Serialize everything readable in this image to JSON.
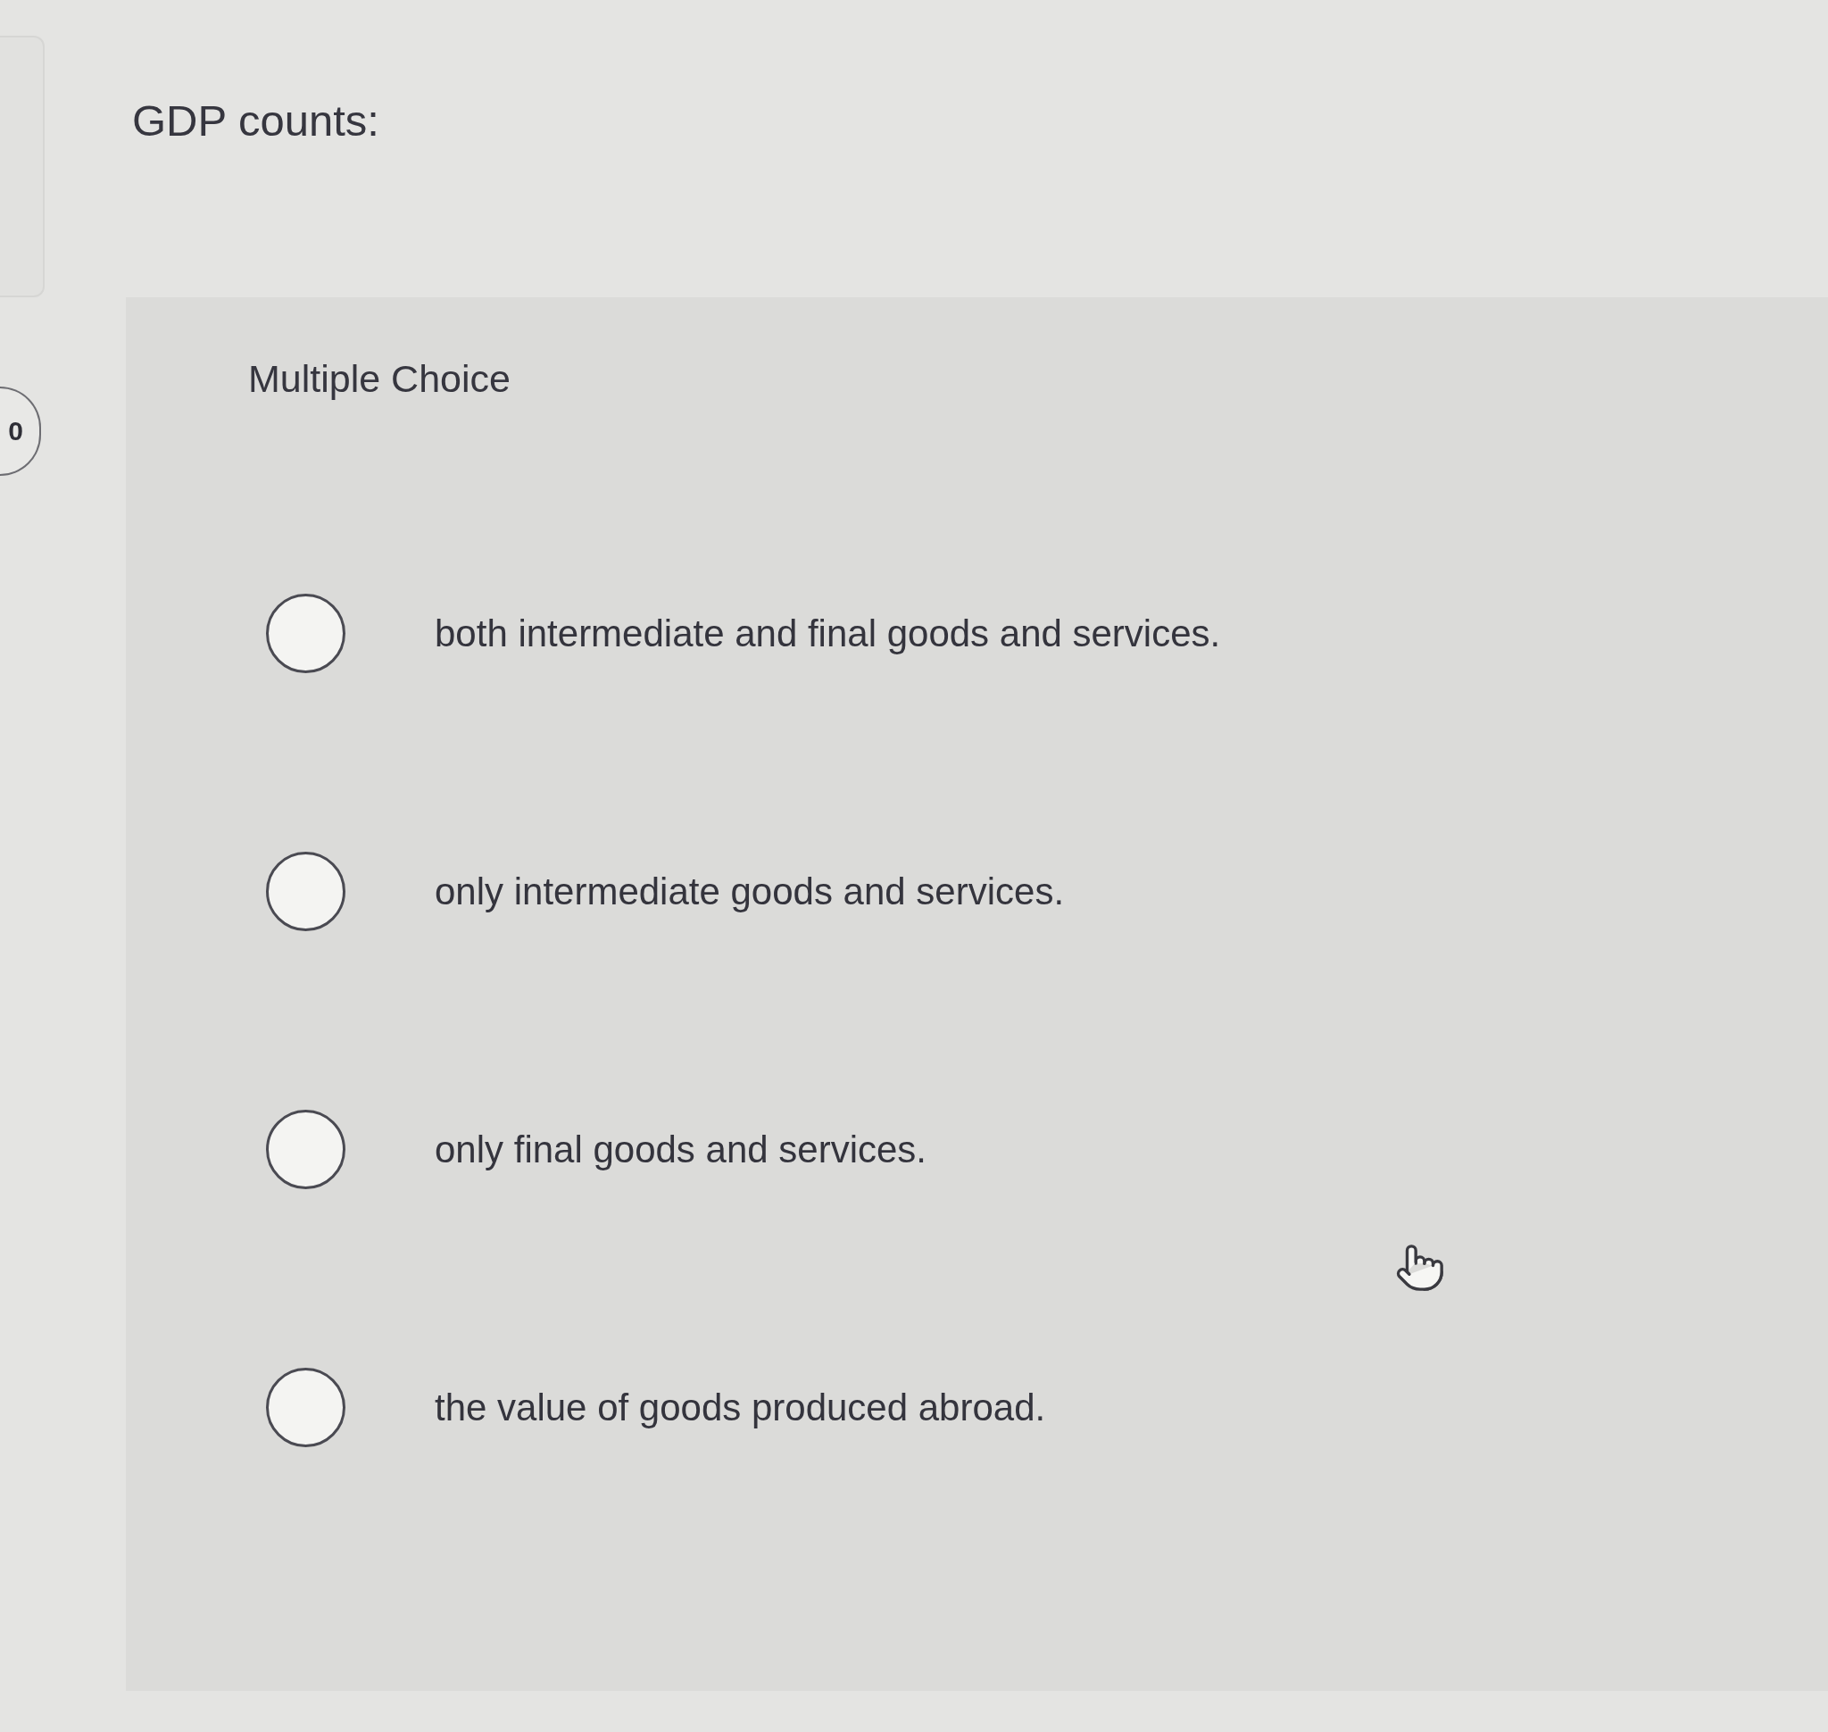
{
  "sidebar_badge": {
    "text": "0"
  },
  "question": {
    "prompt": "GDP counts:"
  },
  "answer_panel": {
    "heading": "Multiple Choice",
    "options": [
      {
        "label": "both intermediate and final goods and services.",
        "selected": false
      },
      {
        "label": "only intermediate goods and services.",
        "selected": false
      },
      {
        "label": "only final goods and services.",
        "selected": false
      },
      {
        "label": "the value of goods produced abroad.",
        "selected": false
      }
    ]
  }
}
